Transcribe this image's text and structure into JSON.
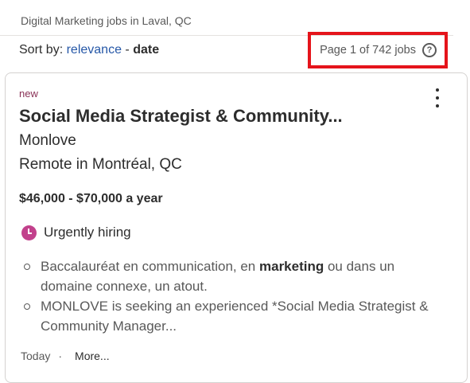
{
  "search": {
    "heading": "Digital Marketing jobs in Laval, QC"
  },
  "sort": {
    "prefix": "Sort by:",
    "relevance": "relevance",
    "separator": " - ",
    "date": "date"
  },
  "pagination": {
    "text": "Page 1 of 742 jobs",
    "help_icon": "?"
  },
  "job": {
    "badge": "new",
    "title": "Social Media Strategist & Community...",
    "company": "Monlove",
    "location": "Remote in Montréal, QC",
    "salary": "$46,000 - $70,000 a year",
    "urgent": "Urgently hiring",
    "snippet": [
      {
        "before": "Baccalauréat en communication, en ",
        "bold": "marketing",
        "after": " ou dans un domaine connexe, un atout."
      },
      {
        "before": "MONLOVE is seeking an experienced *Social Media Strategist & Community Manager...",
        "bold": "",
        "after": ""
      }
    ],
    "posted": "Today",
    "dot": "·",
    "more": "More..."
  },
  "colors": {
    "link": "#2557a7",
    "highlight_box": "#e5141b",
    "new_badge": "#8a3257",
    "urgent_icon": "#c2418c"
  }
}
